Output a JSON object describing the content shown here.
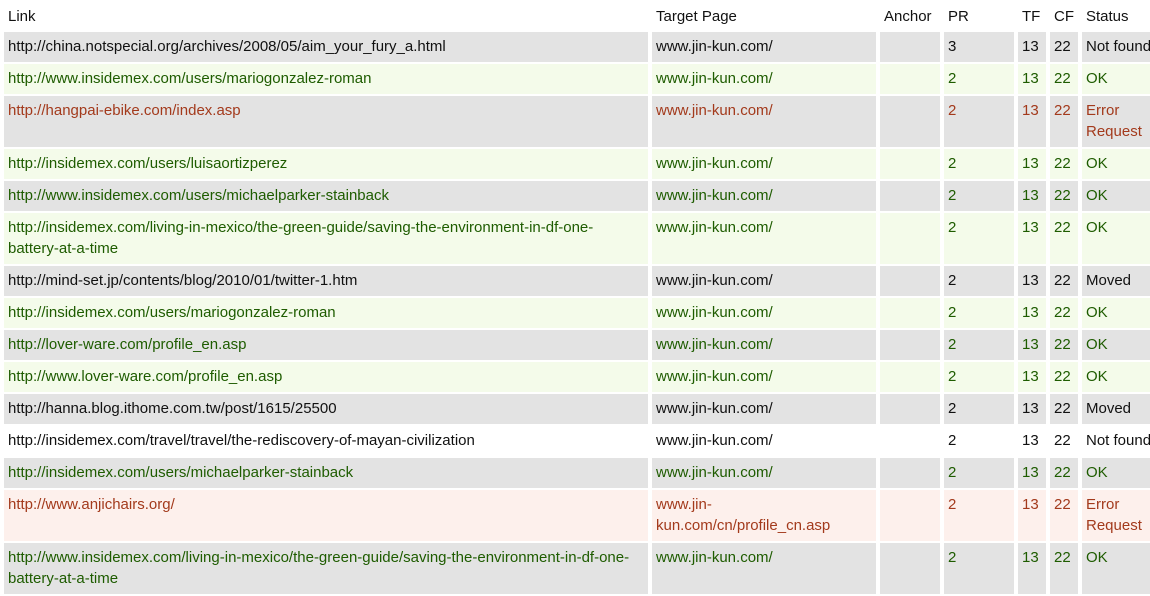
{
  "headers": {
    "link": "Link",
    "target": "Target Page",
    "anchor": "Anchor",
    "pr": "PR",
    "tf": "TF",
    "cf": "CF",
    "status": "Status"
  },
  "rows": [
    {
      "style": "gray",
      "link": "http://china.notspecial.org/archives/2008/05/aim_your_fury_a.html",
      "target": "www.jin-kun.com/",
      "anchor": "",
      "pr": "3",
      "tf": "13",
      "cf": "22",
      "status": "Not found"
    },
    {
      "style": "green",
      "link": "http://www.insidemex.com/users/mariogonzalez-roman",
      "target": "www.jin-kun.com/",
      "anchor": "",
      "pr": "2",
      "tf": "13",
      "cf": "22",
      "status": "OK"
    },
    {
      "style": "gray-err",
      "link": "http://hangpai-ebike.com/index.asp",
      "target": "www.jin-kun.com/",
      "anchor": "",
      "pr": "2",
      "tf": "13",
      "cf": "22",
      "status": "Error Request"
    },
    {
      "style": "green",
      "link": "http://insidemex.com/users/luisaortizperez",
      "target": "www.jin-kun.com/",
      "anchor": "",
      "pr": "2",
      "tf": "13",
      "cf": "22",
      "status": "OK"
    },
    {
      "style": "gray-ok",
      "link": "http://www.insidemex.com/users/michaelparker-stainback",
      "target": "www.jin-kun.com/",
      "anchor": "",
      "pr": "2",
      "tf": "13",
      "cf": "22",
      "status": "OK"
    },
    {
      "style": "green",
      "link": "http://insidemex.com/living-in-mexico/the-green-guide/saving-the-environment-in-df-one-battery-at-a-time",
      "target": "www.jin-kun.com/",
      "anchor": "",
      "pr": "2",
      "tf": "13",
      "cf": "22",
      "status": "OK"
    },
    {
      "style": "gray",
      "link": "http://mind-set.jp/contents/blog/2010/01/twitter-1.htm",
      "target": "www.jin-kun.com/",
      "anchor": "",
      "pr": "2",
      "tf": "13",
      "cf": "22",
      "status": "Moved"
    },
    {
      "style": "green",
      "link": "http://insidemex.com/users/mariogonzalez-roman",
      "target": "www.jin-kun.com/",
      "anchor": "",
      "pr": "2",
      "tf": "13",
      "cf": "22",
      "status": "OK"
    },
    {
      "style": "gray-ok",
      "link": "http://lover-ware.com/profile_en.asp",
      "target": "www.jin-kun.com/",
      "anchor": "",
      "pr": "2",
      "tf": "13",
      "cf": "22",
      "status": "OK"
    },
    {
      "style": "green",
      "link": "http://www.lover-ware.com/profile_en.asp",
      "target": "www.jin-kun.com/",
      "anchor": "",
      "pr": "2",
      "tf": "13",
      "cf": "22",
      "status": "OK"
    },
    {
      "style": "gray",
      "link": "http://hanna.blog.ithome.com.tw/post/1615/25500",
      "target": "www.jin-kun.com/",
      "anchor": "",
      "pr": "2",
      "tf": "13",
      "cf": "22",
      "status": "Moved"
    },
    {
      "style": "white",
      "link": "http://insidemex.com/travel/travel/the-rediscovery-of-mayan-civilization",
      "target": "www.jin-kun.com/",
      "anchor": "",
      "pr": "2",
      "tf": "13",
      "cf": "22",
      "status": "Not found"
    },
    {
      "style": "gray-ok",
      "link": "http://insidemex.com/users/michaelparker-stainback",
      "target": "www.jin-kun.com/",
      "anchor": "",
      "pr": "2",
      "tf": "13",
      "cf": "22",
      "status": "OK"
    },
    {
      "style": "pink",
      "link": "http://www.anjichairs.org/",
      "target": "www.jin-kun.com/cn/profile_cn.asp",
      "anchor": "",
      "pr": "2",
      "tf": "13",
      "cf": "22",
      "status": "Error Request"
    },
    {
      "style": "gray-ok",
      "link": "http://www.insidemex.com/living-in-mexico/the-green-guide/saving-the-environment-in-df-one-battery-at-a-time",
      "target": "www.jin-kun.com/",
      "anchor": "",
      "pr": "2",
      "tf": "13",
      "cf": "22",
      "status": "OK"
    }
  ]
}
